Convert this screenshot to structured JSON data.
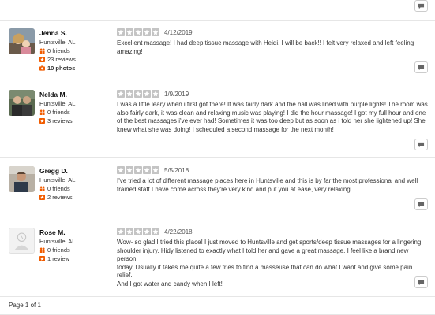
{
  "reviews": [
    {
      "name": "Jenna S.",
      "location": "Huntsville, AL",
      "friends": "0 friends",
      "reviews": "23 reviews",
      "photos": "10 photos",
      "rating": 5,
      "date": "4/12/2019",
      "text": "Excellent massage!  I had deep tissue massage with Heidi.  I will be back!!  I felt very relaxed and left feeling\namazing!"
    },
    {
      "name": "Nelda M.",
      "location": "Huntsville, AL",
      "friends": "0 friends",
      "reviews": "3 reviews",
      "rating": 5,
      "date": "1/9/2019",
      "text": "I was a little leary when i first got there! It was fairly dark and the hall was lined with purple lights! The room was\nalso fairly dark, it was clean and relaxing music was playing! I did the hour massage! I got my full hour and  one\nof the best massages i've ever had! Sometimes it was too deep but as soon as i told her she lightened up! She\nknew what she was doing! I scheduled a second massage for the next month!"
    },
    {
      "name": "Gregg D.",
      "location": "Huntsville, AL",
      "friends": "0 friends",
      "reviews": "2 reviews",
      "rating": 5,
      "date": "5/5/2018",
      "text": "I've tried a lot of different massage places here in Huntsville and this is by far the most professional and well\ntrained staff I have come across they're very kind and put you at ease, very relaxing"
    },
    {
      "name": "Rose M.",
      "location": "Huntsville, AL",
      "friends": "0 friends",
      "reviews": "1 review",
      "rating": 5,
      "date": "4/22/2018",
      "text": "Wow- so glad I tried this place! I just moved to Huntsville and get sports/deep tissue massages for a lingering\nshoulder injury. Hidy listened to exactly what I told her and gave a great massage. I feel like a brand new person\ntoday. Usually it takes me quite a few tries to find a masseuse that can do what I want and give some pain relief.\nAnd I got water and candy when I left!"
    }
  ],
  "pagination": {
    "label": "Page 1 of 1"
  },
  "colors": {
    "star_fill": "#c4c4c4",
    "accent": "#f15c00",
    "divider": "#e6e6e6"
  },
  "icons": {
    "comment": "speech-bubble-icon",
    "friends": "friends-icon",
    "reviews": "star-badge-icon",
    "photos": "camera-icon"
  }
}
